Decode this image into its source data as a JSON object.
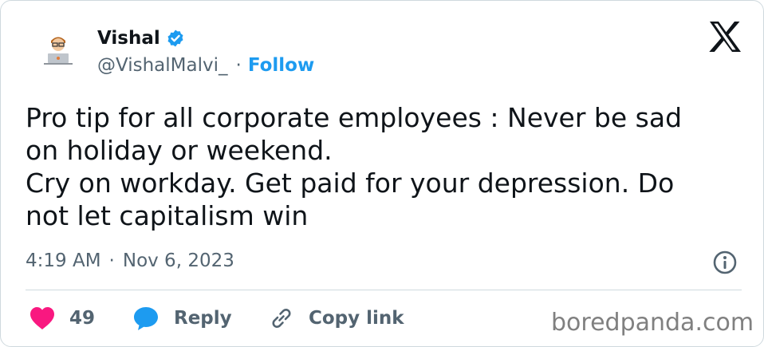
{
  "author": {
    "display_name": "Vishal",
    "handle": "@VishalMalvi_",
    "verified": true,
    "follow_label": "Follow",
    "separator": "·"
  },
  "tweet": {
    "lines": [
      "Pro tip for all corporate employees : Never be sad",
      "on holiday or weekend.",
      "Cry on workday. Get paid for your depression. Do",
      "not let capitalism win"
    ],
    "time": "4:19 AM",
    "date_separator": "·",
    "date": "Nov 6, 2023"
  },
  "actions": {
    "like_count": "49",
    "reply_label": "Reply",
    "copy_label": "Copy link"
  },
  "watermark": "boredpanda.com",
  "icons": {
    "avatar": "avatar-icon",
    "verified": "verified-badge-icon",
    "x_logo": "x-logo-icon",
    "info": "info-icon",
    "heart": "heart-icon",
    "reply": "reply-bubble-icon",
    "link": "link-icon"
  },
  "colors": {
    "accent_blue": "#1d9bf0",
    "heart": "#f91880",
    "secondary_text": "#536471",
    "primary_text": "#0f1419"
  }
}
